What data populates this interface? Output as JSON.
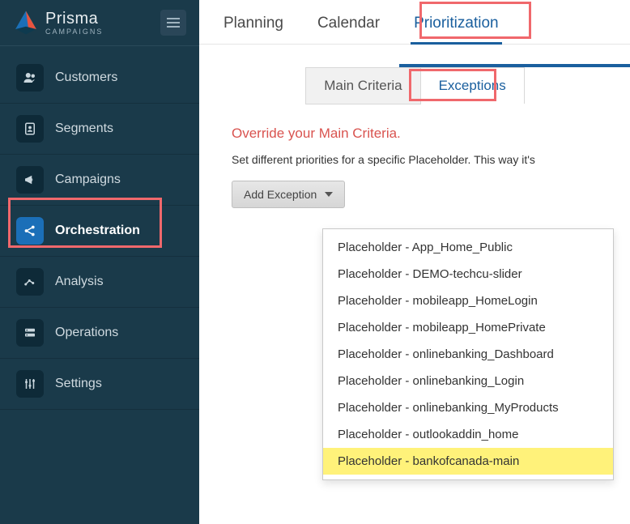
{
  "brand": {
    "title": "Prisma",
    "subtitle": "CAMPAIGNS"
  },
  "sidebar": {
    "items": [
      {
        "label": "Customers",
        "icon": "users"
      },
      {
        "label": "Segments",
        "icon": "segment"
      },
      {
        "label": "Campaigns",
        "icon": "megaphone"
      },
      {
        "label": "Orchestration",
        "icon": "share",
        "active": true
      },
      {
        "label": "Analysis",
        "icon": "chart"
      },
      {
        "label": "Operations",
        "icon": "server"
      },
      {
        "label": "Settings",
        "icon": "sliders"
      }
    ]
  },
  "topTabs": {
    "items": [
      {
        "label": "Planning"
      },
      {
        "label": "Calendar"
      },
      {
        "label": "Prioritization",
        "active": true
      }
    ]
  },
  "subTabs": {
    "items": [
      {
        "label": "Main Criteria"
      },
      {
        "label": "Exceptions",
        "active": true
      }
    ]
  },
  "panel": {
    "title": "Override your Main Criteria.",
    "description": "Set different priorities for a specific Placeholder. This way it's",
    "addButton": "Add Exception"
  },
  "dropdown": {
    "items": [
      "Placeholder - App_Home_Public",
      "Placeholder - DEMO-techcu-slider",
      "Placeholder - mobileapp_HomeLogin",
      "Placeholder - mobileapp_HomePrivate",
      "Placeholder - onlinebanking_Dashboard",
      "Placeholder - onlinebanking_Login",
      "Placeholder - onlinebanking_MyProducts",
      "Placeholder - outlookaddin_home",
      "Placeholder - bankofcanada-main"
    ],
    "highlightedIndex": 8
  }
}
